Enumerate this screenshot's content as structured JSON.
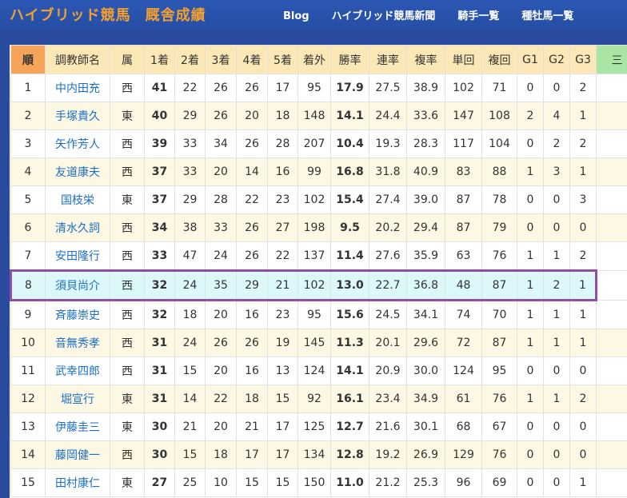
{
  "header": {
    "site_name": "ハイブリッド競馬",
    "page_name": "厩舎成績",
    "nav": [
      "Blog",
      "ハイブリッド競馬新聞",
      "騎手一覧",
      "種牡馬一覧"
    ]
  },
  "colors": {
    "header_bg": "#2a4a9e",
    "title": "#f2a030",
    "highlight_border": "#8e4fa4",
    "highlight_bg": "#ddf8fb",
    "link": "#1a6fc9"
  },
  "table": {
    "columns": [
      "順",
      "調教師名",
      "属",
      "1着",
      "2着",
      "3着",
      "4着",
      "5着",
      "着外",
      "勝率",
      "連率",
      "複率",
      "単回",
      "複回",
      "G1",
      "G2",
      "G3",
      "三"
    ],
    "highlighted_rank": 8,
    "rows": [
      [
        "1",
        "中内田充",
        "西",
        "41",
        "22",
        "26",
        "26",
        "17",
        "95",
        "17.9",
        "27.5",
        "38.9",
        "102",
        "71",
        "0",
        "0",
        "2"
      ],
      [
        "2",
        "手塚貴久",
        "東",
        "40",
        "29",
        "26",
        "20",
        "18",
        "148",
        "14.1",
        "24.4",
        "33.6",
        "147",
        "108",
        "2",
        "4",
        "1"
      ],
      [
        "3",
        "矢作芳人",
        "西",
        "39",
        "33",
        "34",
        "26",
        "28",
        "207",
        "10.4",
        "19.3",
        "28.3",
        "117",
        "104",
        "0",
        "2",
        "2"
      ],
      [
        "4",
        "友道康夫",
        "西",
        "37",
        "33",
        "20",
        "14",
        "16",
        "99",
        "16.8",
        "31.8",
        "40.9",
        "83",
        "88",
        "1",
        "3",
        "1"
      ],
      [
        "5",
        "国枝栄",
        "東",
        "37",
        "29",
        "28",
        "22",
        "23",
        "102",
        "15.4",
        "27.4",
        "39.0",
        "87",
        "78",
        "0",
        "0",
        "3"
      ],
      [
        "6",
        "清水久詞",
        "西",
        "34",
        "38",
        "33",
        "26",
        "27",
        "198",
        "9.5",
        "20.2",
        "29.4",
        "87",
        "79",
        "0",
        "0",
        "0"
      ],
      [
        "7",
        "安田隆行",
        "西",
        "33",
        "47",
        "24",
        "26",
        "22",
        "137",
        "11.4",
        "27.6",
        "35.9",
        "63",
        "76",
        "1",
        "1",
        "2"
      ],
      [
        "8",
        "須貝尚介",
        "西",
        "32",
        "24",
        "35",
        "29",
        "21",
        "102",
        "13.0",
        "22.7",
        "36.8",
        "48",
        "87",
        "1",
        "2",
        "1"
      ],
      [
        "9",
        "斉藤崇史",
        "西",
        "32",
        "18",
        "20",
        "16",
        "23",
        "95",
        "15.6",
        "24.5",
        "34.1",
        "74",
        "70",
        "1",
        "1",
        "1"
      ],
      [
        "10",
        "音無秀孝",
        "西",
        "31",
        "24",
        "26",
        "26",
        "19",
        "145",
        "11.3",
        "20.1",
        "29.6",
        "72",
        "87",
        "1",
        "1",
        "1"
      ],
      [
        "11",
        "武幸四郎",
        "西",
        "31",
        "15",
        "20",
        "16",
        "13",
        "124",
        "14.1",
        "20.9",
        "30.0",
        "124",
        "95",
        "0",
        "0",
        "0"
      ],
      [
        "12",
        "堀宣行",
        "東",
        "31",
        "14",
        "22",
        "18",
        "15",
        "92",
        "16.1",
        "23.4",
        "34.9",
        "61",
        "76",
        "1",
        "1",
        "2"
      ],
      [
        "13",
        "伊藤圭三",
        "東",
        "30",
        "21",
        "20",
        "21",
        "17",
        "125",
        "12.7",
        "21.6",
        "30.1",
        "68",
        "67",
        "0",
        "0",
        "0"
      ],
      [
        "14",
        "藤岡健一",
        "西",
        "30",
        "15",
        "18",
        "17",
        "17",
        "134",
        "12.8",
        "19.2",
        "26.9",
        "129",
        "76",
        "0",
        "0",
        "0"
      ],
      [
        "15",
        "田村康仁",
        "東",
        "27",
        "25",
        "10",
        "15",
        "15",
        "150",
        "11.0",
        "21.2",
        "25.3",
        "96",
        "69",
        "0",
        "0",
        "1"
      ]
    ]
  }
}
